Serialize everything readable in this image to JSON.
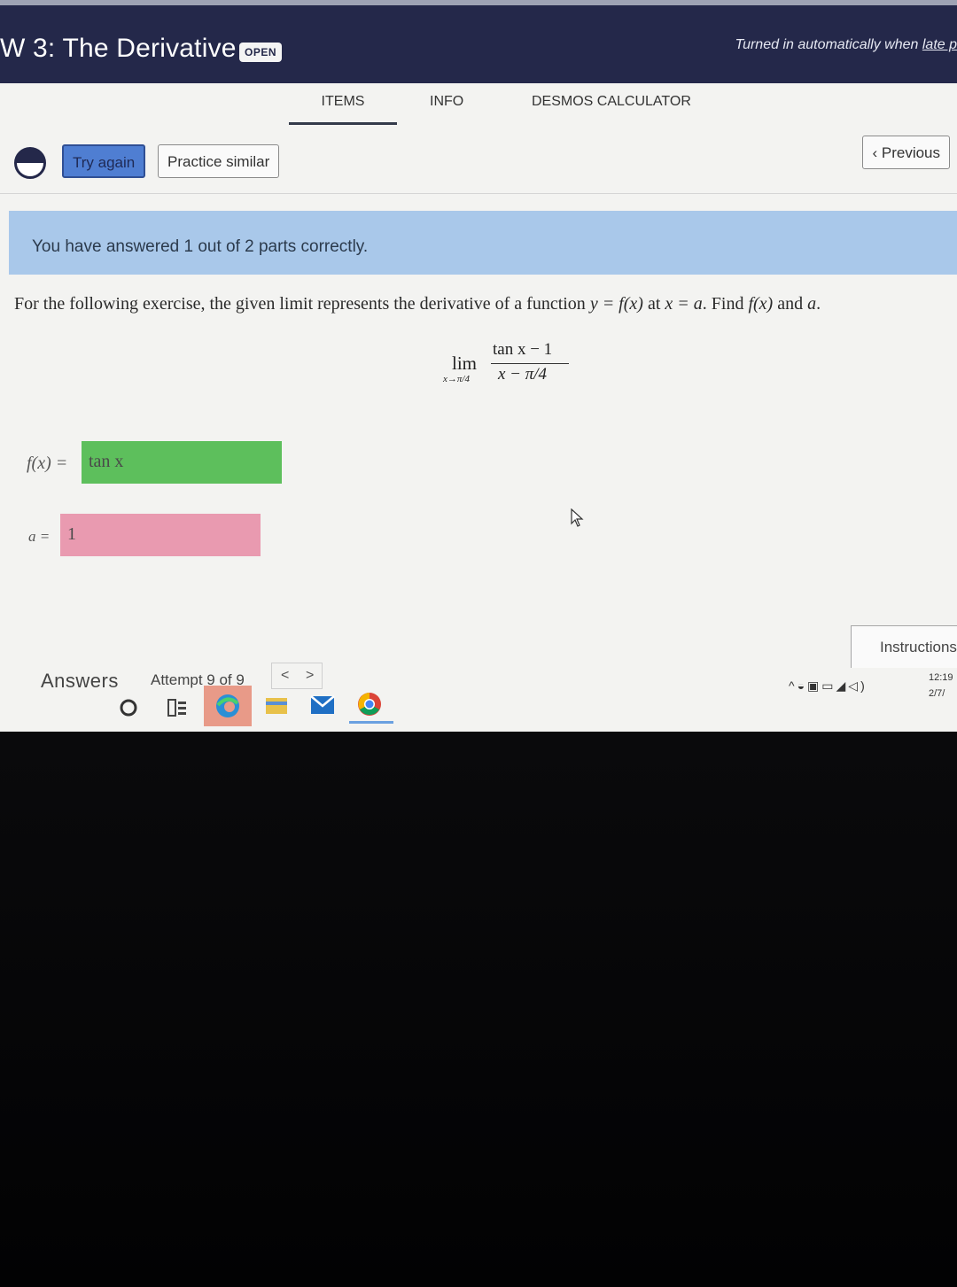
{
  "header": {
    "title": "W 3: The Derivative",
    "badge": "OPEN",
    "notice_prefix": "Turned in automatically when ",
    "notice_link": "late p"
  },
  "tabs": [
    {
      "label": "ITEMS",
      "active": true
    },
    {
      "label": "INFO",
      "active": false
    },
    {
      "label": "DESMOS CALCULATOR",
      "active": false
    }
  ],
  "toolbar": {
    "try_again": "Try again",
    "practice_similar": "Practice similar",
    "previous": "Previous"
  },
  "alert": "You have answered 1 out of 2 parts correctly.",
  "question": {
    "text_a": "For the following exercise, the given limit represents the derivative of a function ",
    "expr_y": "y = f(x)",
    "text_b": " at ",
    "expr_x": "x = a",
    "text_c": ". Find ",
    "expr_f": "f(x)",
    "text_d": " and ",
    "expr_a": "a",
    "text_e": "."
  },
  "formula": {
    "lim": "lim",
    "sub": "x→π/4",
    "numerator": "tan x − 1",
    "denominator": "x − π/4"
  },
  "answers": {
    "f_label": "f(x) =",
    "f_value": "tan x",
    "f_status": "correct",
    "a_label": "a =",
    "a_value": "1",
    "a_status": "incorrect"
  },
  "footer": {
    "answers_label": "Answers",
    "attempt": "Attempt 9 of 9",
    "instructions": "Instructions"
  },
  "tray": {
    "time": "12:19",
    "date": "2/7/"
  },
  "colors": {
    "header_bg": "#24284a",
    "alert_bg": "#a9c8ea",
    "correct": "#5dbf5c",
    "incorrect": "#e99ab0",
    "try_again_bg": "#4f7ed2"
  }
}
